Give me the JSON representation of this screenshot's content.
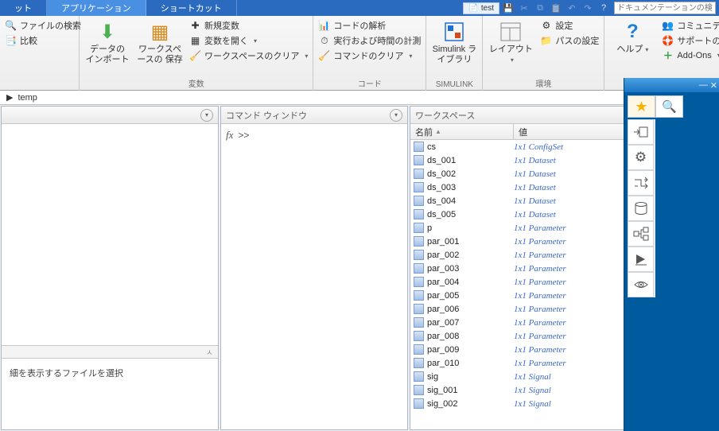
{
  "tabs": {
    "t0": "ット",
    "t1": "アプリケーション",
    "t2": "ショートカット"
  },
  "qat": {
    "doc_label": "test"
  },
  "search": {
    "placeholder": "ドキュメンテーションの検索"
  },
  "ribbon": {
    "g_file": {
      "find": "ファイルの検索",
      "compare": "比較"
    },
    "g_var": {
      "label": "変数",
      "import": "データの\nインポート",
      "savews": "ワークスペースの\n保存",
      "newvar": "新規変数",
      "openvar": "変数を開く",
      "clearws": "ワークスペースのクリア"
    },
    "g_code": {
      "label": "コード",
      "analyze": "コードの解析",
      "timing": "実行および時間の計測",
      "clearcmd": "コマンドのクリア"
    },
    "g_simulink": {
      "label": "SIMULINK",
      "btn": "Simulink\nライブラリ"
    },
    "g_env": {
      "label": "環境",
      "layout": "レイアウト",
      "prefs": "設定",
      "setpath": "パスの設定"
    },
    "g_res": {
      "help": "ヘルプ",
      "community": "コミュニティ",
      "support": "サポートのリクエスト",
      "addons": "Add-Ons"
    }
  },
  "addr": {
    "path": "temp"
  },
  "panels": {
    "left_mid_hint": "ㅅ",
    "details_hint": "細を表示するファイルを選択",
    "cmd_title": "コマンド ウィンドウ",
    "ws_title": "ワークスペース",
    "prompt": ">>",
    "fx": "fx"
  },
  "workspace": {
    "col_name": "名前",
    "col_value": "値",
    "vars": [
      {
        "name": "cs",
        "value": "1x1 ConfigSet"
      },
      {
        "name": "ds_001",
        "value": "1x1 Dataset"
      },
      {
        "name": "ds_002",
        "value": "1x1 Dataset"
      },
      {
        "name": "ds_003",
        "value": "1x1 Dataset"
      },
      {
        "name": "ds_004",
        "value": "1x1 Dataset"
      },
      {
        "name": "ds_005",
        "value": "1x1 Dataset"
      },
      {
        "name": "p",
        "value": "1x1 Parameter"
      },
      {
        "name": "par_001",
        "value": "1x1 Parameter"
      },
      {
        "name": "par_002",
        "value": "1x1 Parameter"
      },
      {
        "name": "par_003",
        "value": "1x1 Parameter"
      },
      {
        "name": "par_004",
        "value": "1x1 Parameter"
      },
      {
        "name": "par_005",
        "value": "1x1 Parameter"
      },
      {
        "name": "par_006",
        "value": "1x1 Parameter"
      },
      {
        "name": "par_007",
        "value": "1x1 Parameter"
      },
      {
        "name": "par_008",
        "value": "1x1 Parameter"
      },
      {
        "name": "par_009",
        "value": "1x1 Parameter"
      },
      {
        "name": "par_010",
        "value": "1x1 Parameter"
      },
      {
        "name": "sig",
        "value": "1x1 Signal"
      },
      {
        "name": "sig_001",
        "value": "1x1 Signal"
      },
      {
        "name": "sig_002",
        "value": "1x1 Signal"
      }
    ]
  }
}
